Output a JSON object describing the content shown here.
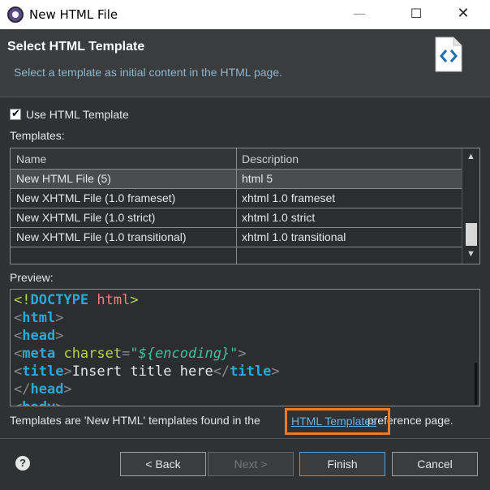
{
  "window": {
    "title": "New HTML File",
    "min": "—",
    "max": "☐",
    "close": "✕"
  },
  "header": {
    "title": "Select HTML Template",
    "description": "Select a template as initial content in the HTML page."
  },
  "options": {
    "use_template_label": "Use HTML Template",
    "use_template_checked": true
  },
  "templates": {
    "label": "Templates:",
    "columns": [
      "Name",
      "Description"
    ],
    "rows": [
      {
        "name": "New HTML File (5)",
        "description": "html 5"
      },
      {
        "name": "New XHTML File (1.0 frameset)",
        "description": "xhtml 1.0 frameset"
      },
      {
        "name": "New XHTML File (1.0 strict)",
        "description": "xhtml 1.0 strict"
      },
      {
        "name": "New XHTML File (1.0 transitional)",
        "description": "xhtml 1.0 transitional"
      }
    ],
    "selected_index": 0
  },
  "preview": {
    "label": "Preview:",
    "lines": {
      "l1_kw": "DOCTYPE",
      "l1_val": "html",
      "l2_tag": "html",
      "l3_tag": "head",
      "l4_tag": "meta",
      "l4_attr": "charset",
      "l4_val": "\"${encoding}\"",
      "l5_tag": "title",
      "l5_text": "Insert title here",
      "l6_tag": "head",
      "l7_tag": "body"
    }
  },
  "footnote": {
    "before": "Templates are 'New HTML' templates found in the",
    "link": "HTML Templates",
    "after": "preference page."
  },
  "buttons": {
    "help": "?",
    "back": "< Back",
    "next": "Next >",
    "finish": "Finish",
    "cancel": "Cancel"
  }
}
